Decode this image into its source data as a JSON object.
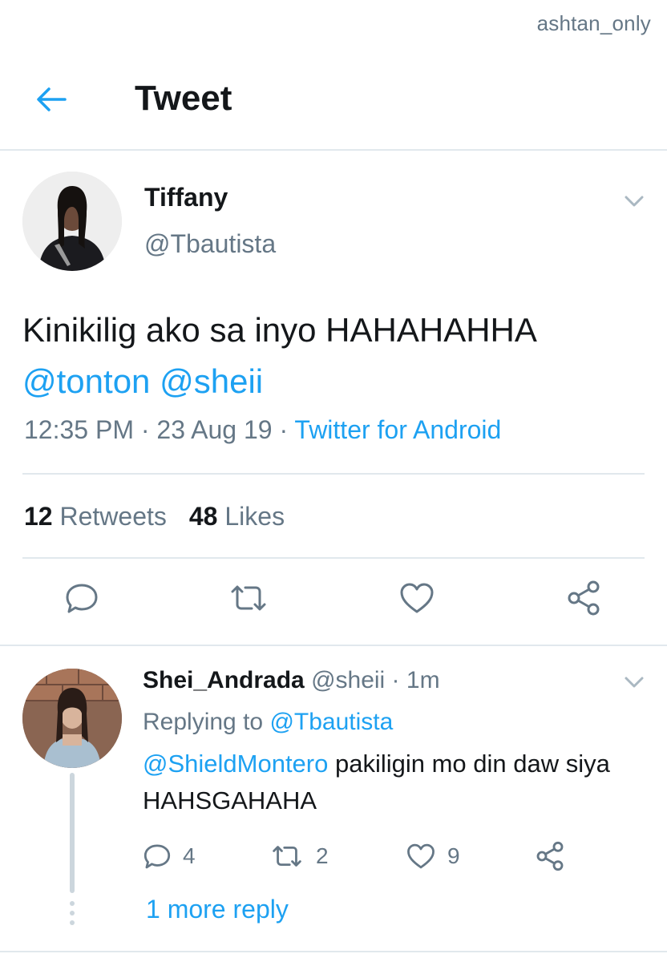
{
  "watermark": "ashtan_only",
  "header": {
    "title": "Tweet",
    "back_icon": "arrow-left-icon"
  },
  "tweet": {
    "name": "Tiffany",
    "handle": "@Tbautista",
    "text_plain": "Kinikilig ako sa inyo HAHAHAHHA",
    "mention1": "@tonton",
    "mention2": "@sheii",
    "time": "12:35 PM",
    "sep1": " · ",
    "date": "23 Aug 19",
    "sep2": " · ",
    "source": "Twitter for Android",
    "retweets_count": "12",
    "retweets_label": "Retweets",
    "likes_count": "48",
    "likes_label": "Likes"
  },
  "reply": {
    "name": "Shei_Andrada",
    "handle_time": " @sheii · 1m",
    "replying_prefix": "Replying to ",
    "replying_to": "@Tbautista",
    "mention": "@ShieldMontero",
    "text": " pakiligin mo din daw siya HAHSGAHAHA",
    "reply_count": "4",
    "retweet_count": "2",
    "like_count": "9",
    "more_reply": "1 more reply"
  },
  "colors": {
    "accent": "#1da1f2",
    "muted": "#657786",
    "text": "#14171a",
    "rule": "#e1e8ed"
  }
}
